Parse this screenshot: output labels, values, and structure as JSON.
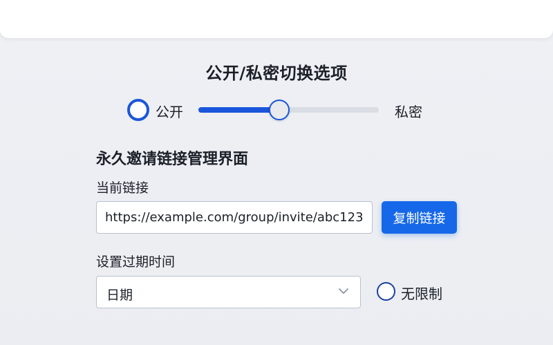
{
  "visibility": {
    "title": "公开/私密切换选项",
    "public_label": "公开",
    "private_label": "私密",
    "slider_value_percent": 45,
    "accent_color": "#1a56db"
  },
  "invite": {
    "heading": "永久邀请链接管理界面",
    "current_link_label": "当前链接",
    "current_link_value": "https://example.com/group/invite/abc123",
    "copy_button_label": "复制链接",
    "expiry_label": "设置过期时间",
    "expiry_selected": "日期",
    "unlimited_label": "无限制",
    "button_color": "#1668e8"
  },
  "icons": {
    "dropdown": "chevron-down-icon"
  }
}
